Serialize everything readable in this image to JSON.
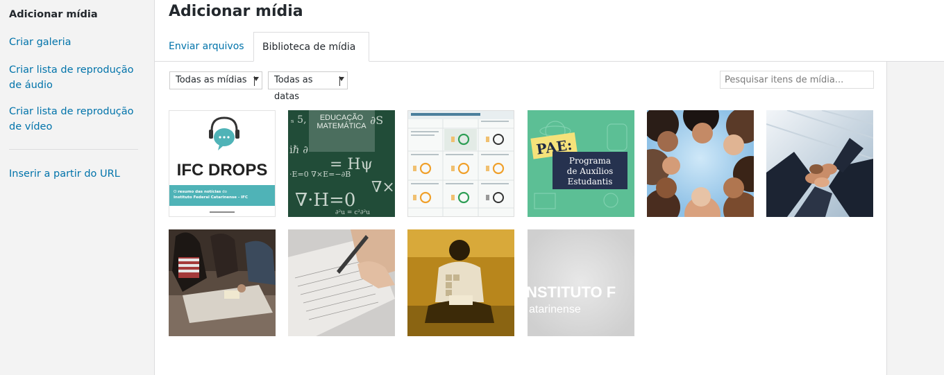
{
  "sidebar": {
    "items": [
      {
        "label": "Adicionar mídia",
        "active": true
      },
      {
        "label": "Criar galeria"
      },
      {
        "label": "Criar lista de reprodução de áudio"
      },
      {
        "label": "Criar lista de reprodução de vídeo"
      },
      {
        "label": "Inserir a partir do URL"
      }
    ]
  },
  "header": {
    "title": "Adicionar mídia"
  },
  "tabs": [
    {
      "label": "Enviar arquivos"
    },
    {
      "label": "Biblioteca de mídia",
      "active": true
    }
  ],
  "filters": {
    "type_selected": "Todas as mídias",
    "date_selected": "Todas as datas",
    "search_placeholder": "Pesquisar itens de mídia..."
  },
  "media": {
    "ifc_drops": {
      "logo": "IFC DROPS",
      "caption_bold": "resumo das notícias",
      "caption_pre": "O",
      "caption_post": "do",
      "caption_line2": "Instituto Federal Catarinense - IFC"
    },
    "educacao": {
      "title_line1": "EDUCAÇÃO",
      "title_line2": "MATEMÁTICA"
    },
    "pae": {
      "title": "PAE:",
      "line1": "Programa",
      "line2": "de Auxílios",
      "line3": "Estudantis"
    },
    "instituto": {
      "line1": "NSTITUTO F",
      "line2": "atarinense"
    }
  },
  "colors": {
    "link": "#0073aa",
    "text": "#23282d",
    "sidebar_bg": "#f3f3f3",
    "teal": "#4fb3b7"
  }
}
